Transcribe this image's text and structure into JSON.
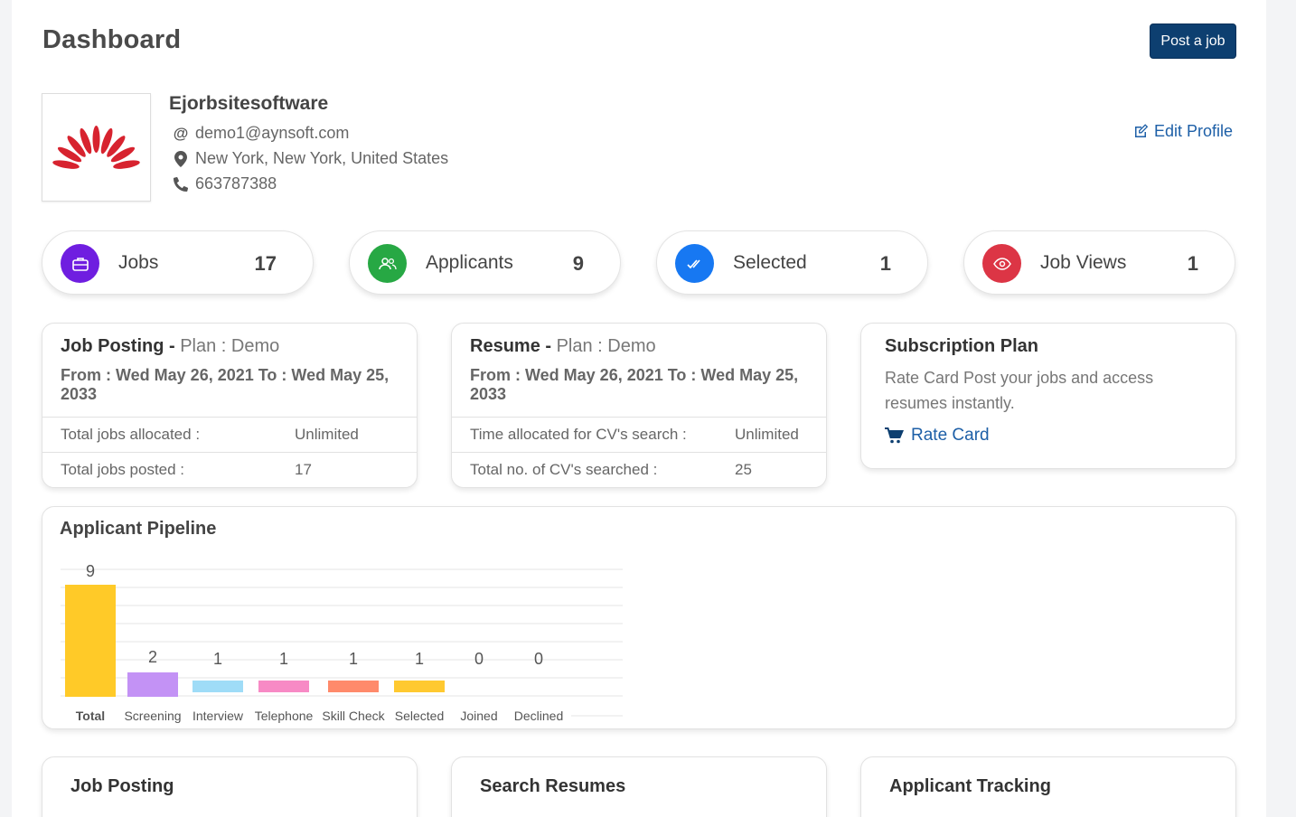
{
  "header": {
    "title": "Dashboard",
    "post_job_label": "Post a job"
  },
  "profile": {
    "company": "Ejorbsitesoftware",
    "email": "demo1@aynsoft.com",
    "location": "New York, New York, United States",
    "phone": "663787388",
    "edit_label": "Edit Profile"
  },
  "stats": [
    {
      "label": "Jobs",
      "value": "17",
      "icon": "briefcase-icon",
      "color": "#6f1ee0"
    },
    {
      "label": "Applicants",
      "value": "9",
      "icon": "users-icon",
      "color": "#27a844"
    },
    {
      "label": "Selected",
      "value": "1",
      "icon": "double-check-icon",
      "color": "#1778f2"
    },
    {
      "label": "Job Views",
      "value": "1",
      "icon": "eye-icon",
      "color": "#dc3545"
    }
  ],
  "job_posting_card": {
    "title": "Job Posting - ",
    "plan": "Plan : Demo",
    "dates": "From : Wed May 26, 2021   To : Wed May 25, 2033",
    "rows": [
      {
        "label": "Total jobs allocated :",
        "value": "Unlimited"
      },
      {
        "label": "Total jobs posted :",
        "value": "17"
      }
    ]
  },
  "resume_card": {
    "title": "Resume - ",
    "plan": "Plan : Demo",
    "dates": "From : Wed May 26, 2021   To : Wed May 25, 2033",
    "rows": [
      {
        "label": "Time allocated for CV's search :",
        "value": "Unlimited"
      },
      {
        "label": "Total no. of CV's searched :",
        "value": "25"
      }
    ]
  },
  "subscription_card": {
    "title": "Subscription Plan",
    "text": "Rate Card Post your jobs and access resumes instantly.",
    "link_label": "Rate Card"
  },
  "pipeline": {
    "title": "Applicant Pipeline"
  },
  "chart_data": {
    "type": "bar",
    "categories": [
      "Total",
      "Screening",
      "Interview",
      "Telephone",
      "Skill Check",
      "Selected",
      "Joined",
      "Declined"
    ],
    "values": [
      9,
      2,
      1,
      1,
      1,
      1,
      0,
      0
    ],
    "colors": [
      "#ffca28",
      "#c392f5",
      "#9fdcf7",
      "#f78ac5",
      "#ff8a6b",
      "#ffc930",
      "#cccccc",
      "#cccccc"
    ],
    "title": "Applicant Pipeline",
    "ylim": [
      0,
      9
    ],
    "grid": true,
    "data_labels": true
  },
  "bottom_cards": [
    {
      "title": "Job Posting"
    },
    {
      "title": "Search Resumes"
    },
    {
      "title": "Applicant Tracking"
    }
  ]
}
